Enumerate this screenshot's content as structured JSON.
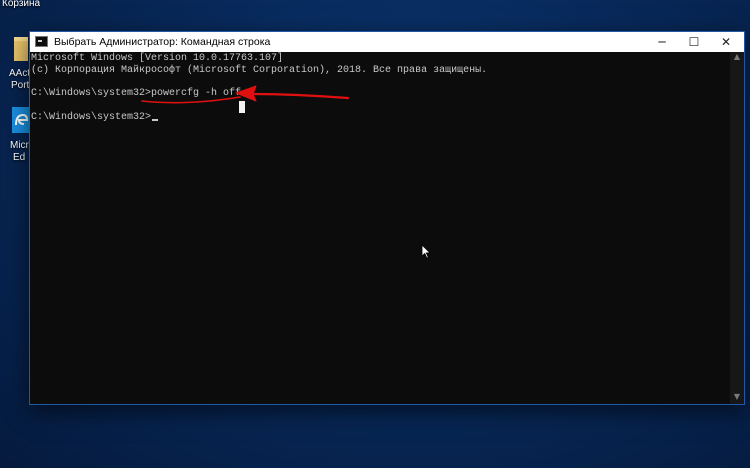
{
  "desktop": {
    "recycle_bin_label": "Корзина",
    "icon2_label_line1": "AAct",
    "icon2_label_line2": "Port",
    "icon3_label_line1": "Micr",
    "icon3_label_line2": "Ed"
  },
  "window": {
    "title": "Выбрать Администратор: Командная строка",
    "minimize_label": "─",
    "maximize_label": "☐",
    "close_label": "✕"
  },
  "console": {
    "line1": "Microsoft Windows [Version 10.0.17763.107]",
    "line2": "(c) Корпорация Майкрософт (Microsoft Corporation), 2018. Все права защищены.",
    "prompt1": "C:\\Windows\\system32>",
    "command": "powercfg -h off",
    "prompt2": "C:\\Windows\\system32>"
  },
  "annotation": {
    "color": "#e01010"
  },
  "colors": {
    "console_bg": "#0c0c0c",
    "console_text": "#c8c8c8",
    "titlebar_bg": "#ffffff",
    "desktop_bg": "#082a5c"
  }
}
